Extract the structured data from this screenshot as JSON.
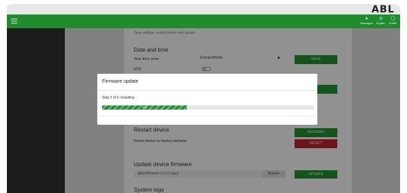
{
  "brand": {
    "logo": "ABL"
  },
  "topbar": {
    "actions": [
      {
        "label": "Messages",
        "icon": "bell-icon",
        "glyph": "▲"
      },
      {
        "label": "English",
        "icon": "globe-icon",
        "glyph": "◎"
      },
      {
        "label": "Profile",
        "icon": "user-icon",
        "glyph": "◯"
      }
    ]
  },
  "page": {
    "subtitle": "Time settings, restart device and update",
    "date_time": {
      "title": "Date and time",
      "timezone_label": "Your time zone",
      "timezone_value": "Europe/Berlin",
      "save_label": "SAVE",
      "ntp_label": "NTP"
    },
    "restart": {
      "title": "Restart device",
      "restart_label": "RESTART",
      "factory_label": "Reset device to factory defaults",
      "reset_label": "RESET"
    },
    "firmware": {
      "title": "Update device firmware",
      "file_name": "ablevM5home-v1.0.0.rauch",
      "browse_label": "Browse",
      "update_label": "UPDATE"
    },
    "logs": {
      "title": "System logs"
    }
  },
  "modal": {
    "title": "Firmware update",
    "step_text": "Step 3 of 6: Installing",
    "progress_label": "40%",
    "progress_value": 0.4
  },
  "colors": {
    "brand_green": "#1f8d2e",
    "danger_red": "#b5252c"
  }
}
